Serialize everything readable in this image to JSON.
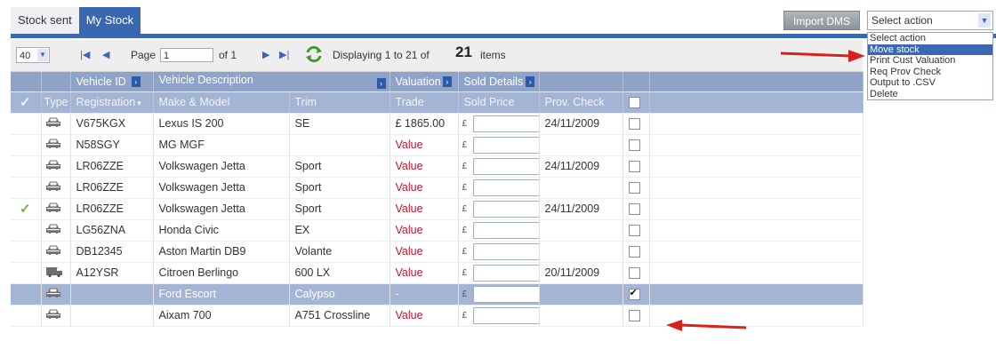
{
  "tabs": [
    {
      "label": "Stock sent",
      "active": false
    },
    {
      "label": "My Stock",
      "active": true
    }
  ],
  "import_button": "Import DMS",
  "action_select": {
    "value": "Select action",
    "options": [
      "Select action",
      "Move stock",
      "Print Cust Valuation",
      "Req Prov Check",
      "Output to .CSV",
      "Delete"
    ],
    "highlighted": "Move stock"
  },
  "toolbar": {
    "page_size": "40",
    "page_label": "Page",
    "page_value": "1",
    "of_label": "of 1",
    "displaying": "Displaying 1 to 21 of",
    "total": "21",
    "items_label": "items"
  },
  "columns": {
    "group_vehicle_id": "Vehicle ID",
    "group_vehicle_desc": "Vehicle Description",
    "group_valuation": "Valuation",
    "group_sold": "Sold Details",
    "type": "Type",
    "registration": "Registration",
    "make_model": "Make & Model",
    "trim": "Trim",
    "trade": "Trade",
    "sold_price": "Sold Price",
    "prov_check": "Prov. Check"
  },
  "pound": "£",
  "rows": [
    {
      "tick": false,
      "type": "car",
      "reg": "V675KGX",
      "model": "Lexus IS 200",
      "trim": "SE",
      "trade": "£ 1865.00",
      "trade_red": false,
      "prov": "24/11/2009",
      "checked": false,
      "selected": false
    },
    {
      "tick": false,
      "type": "car",
      "reg": "N58SGY",
      "model": "MG MGF",
      "trim": "",
      "trade": "Value",
      "trade_red": true,
      "prov": "",
      "checked": false,
      "selected": false
    },
    {
      "tick": false,
      "type": "car",
      "reg": "LR06ZZE",
      "model": "Volkswagen Jetta",
      "trim": "Sport",
      "trade": "Value",
      "trade_red": true,
      "prov": "24/11/2009",
      "checked": false,
      "selected": false
    },
    {
      "tick": false,
      "type": "car",
      "reg": "LR06ZZE",
      "model": "Volkswagen Jetta",
      "trim": "Sport",
      "trade": "Value",
      "trade_red": true,
      "prov": "",
      "checked": false,
      "selected": false
    },
    {
      "tick": true,
      "type": "car",
      "reg": "LR06ZZE",
      "model": "Volkswagen Jetta",
      "trim": "Sport",
      "trade": "Value",
      "trade_red": true,
      "prov": "24/11/2009",
      "checked": false,
      "selected": false
    },
    {
      "tick": false,
      "type": "car",
      "reg": "LG56ZNA",
      "model": "Honda Civic",
      "trim": "EX",
      "trade": "Value",
      "trade_red": true,
      "prov": "",
      "checked": false,
      "selected": false
    },
    {
      "tick": false,
      "type": "car",
      "reg": "DB12345",
      "model": "Aston Martin DB9",
      "trim": "Volante",
      "trade": "Value",
      "trade_red": true,
      "prov": "",
      "checked": false,
      "selected": false
    },
    {
      "tick": false,
      "type": "van",
      "reg": "A12YSR",
      "model": "Citroen Berlingo",
      "trim": "600 LX",
      "trade": "Value",
      "trade_red": true,
      "prov": "20/11/2009",
      "checked": false,
      "selected": false
    },
    {
      "tick": false,
      "type": "car",
      "reg": "",
      "model": "Ford Escort",
      "trim": "Calypso",
      "trade": "-",
      "trade_red": false,
      "prov": "",
      "checked": true,
      "selected": true
    },
    {
      "tick": false,
      "type": "car",
      "reg": "",
      "model": "Aixam 700",
      "trim": "A751 Crossline",
      "trade": "Value",
      "trade_red": true,
      "prov": "",
      "checked": false,
      "selected": false
    }
  ],
  "colors": {
    "accent": "#3a67b1",
    "header_dark": "#8fa2c7",
    "header_light": "#a3b4d5",
    "value_red": "#c8102e",
    "annotation_red": "#d9211b",
    "tick_green": "#74b13d"
  }
}
